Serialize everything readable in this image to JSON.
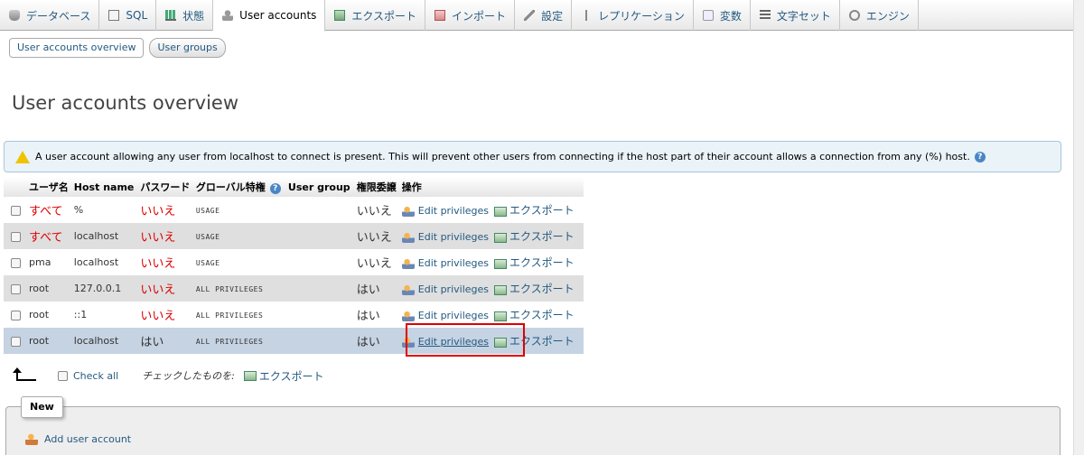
{
  "nav": {
    "tabs": [
      {
        "label": "データベース",
        "icon": "database-icon"
      },
      {
        "label": "SQL",
        "icon": "sql-icon"
      },
      {
        "label": "状態",
        "icon": "status-icon"
      },
      {
        "label": "User accounts",
        "icon": "users-icon",
        "active": true
      },
      {
        "label": "エクスポート",
        "icon": "export-icon"
      },
      {
        "label": "インポート",
        "icon": "import-icon"
      },
      {
        "label": "設定",
        "icon": "wrench-icon"
      },
      {
        "label": "レプリケーション",
        "icon": "replication-icon"
      },
      {
        "label": "変数",
        "icon": "variables-icon"
      },
      {
        "label": "文字セット",
        "icon": "charset-icon"
      },
      {
        "label": "エンジン",
        "icon": "engine-icon"
      }
    ]
  },
  "subtabs": {
    "overview": "User accounts overview",
    "groups": "User groups"
  },
  "page": {
    "title": "User accounts overview"
  },
  "notice": {
    "text": "A user account allowing any user from localhost to connect is present. This will prevent other users from connecting if the host part of their account allows a connection from any (%) host.",
    "help": "?"
  },
  "table": {
    "headers": {
      "user": "ユーザ名",
      "host": "Host name",
      "password": "パスワード",
      "global": "グローバル特権",
      "help": "?",
      "group": "User group",
      "grant": "権限委譲",
      "actions": "操作"
    },
    "rows": [
      {
        "user": "すべて",
        "host": "%",
        "password": "いいえ",
        "privileges": "USAGE",
        "grant": "いいえ",
        "edit": "Edit privileges",
        "export": "エクスポート"
      },
      {
        "user": "すべて",
        "host": "localhost",
        "password": "いいえ",
        "privileges": "USAGE",
        "grant": "いいえ",
        "edit": "Edit privileges",
        "export": "エクスポート"
      },
      {
        "user": "pma",
        "host": "localhost",
        "password": "いいえ",
        "privileges": "USAGE",
        "grant": "いいえ",
        "edit": "Edit privileges",
        "export": "エクスポート"
      },
      {
        "user": "root",
        "host": "127.0.0.1",
        "password": "いいえ",
        "privileges": "ALL PRIVILEGES",
        "grant": "はい",
        "edit": "Edit privileges",
        "export": "エクスポート"
      },
      {
        "user": "root",
        "host": "::1",
        "password": "いいえ",
        "privileges": "ALL PRIVILEGES",
        "grant": "はい",
        "edit": "Edit privileges",
        "export": "エクスポート"
      },
      {
        "user": "root",
        "host": "localhost",
        "password": "はい",
        "privileges": "ALL PRIVILEGES",
        "grant": "はい",
        "edit": "Edit privileges",
        "export": "エクスポート"
      }
    ]
  },
  "footer": {
    "check_all": "Check all",
    "with_selected": "チェックしたものを:",
    "export": "エクスポート"
  },
  "new_section": {
    "legend": "New",
    "add_user": "Add user account"
  },
  "colors": {
    "link": "#235a81",
    "red_text": "#dd0000",
    "highlight_box": "#e00000",
    "notice_bg": "#e9f3f8"
  }
}
